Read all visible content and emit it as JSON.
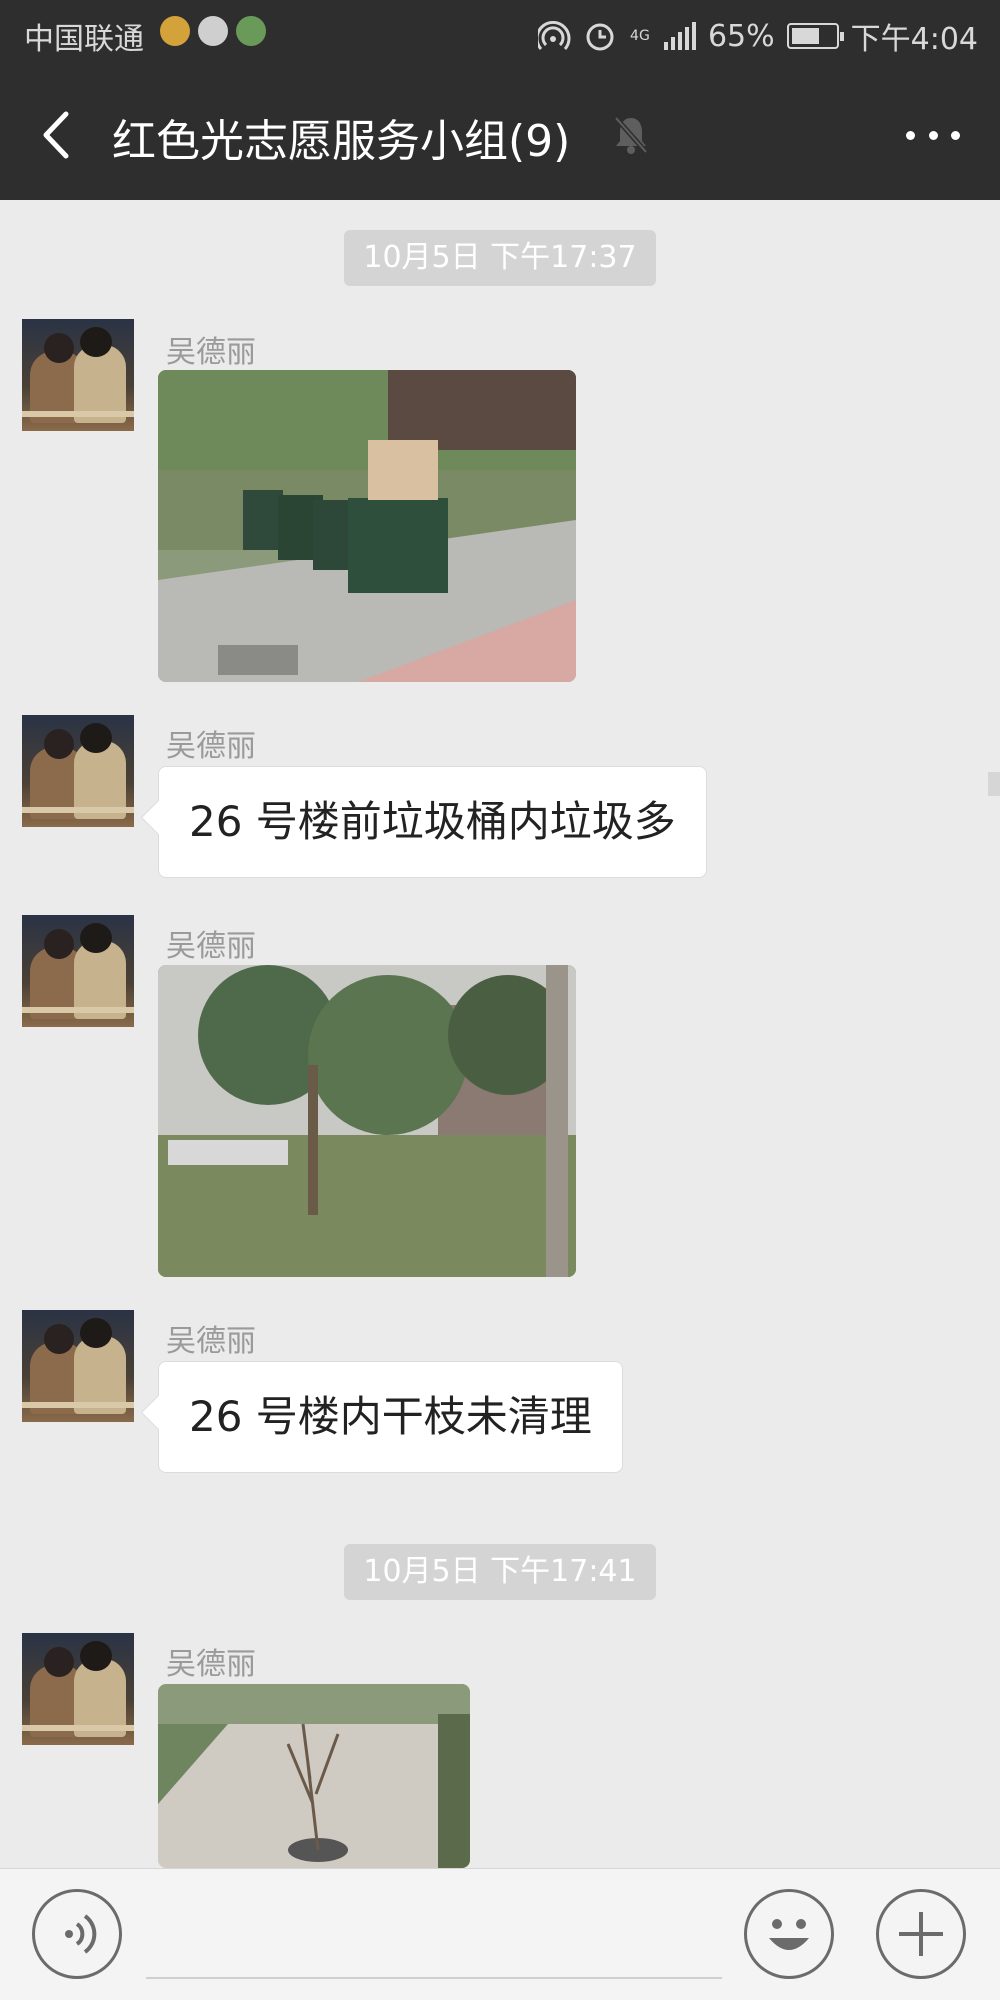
{
  "status_bar": {
    "carrier": "中国联通",
    "battery_percent_text": "65%",
    "battery_level": 0.65,
    "network": "4G",
    "time": "下午4:04"
  },
  "header": {
    "title": "红色光志愿服务小组(9)",
    "muted": true
  },
  "messages": [
    {
      "type": "timestamp",
      "text": "10月5日 下午17:37"
    },
    {
      "type": "image",
      "sender": "吴德丽"
    },
    {
      "type": "text",
      "sender": "吴德丽",
      "text": "26 号楼前垃圾桶内垃圾多"
    },
    {
      "type": "image",
      "sender": "吴德丽"
    },
    {
      "type": "text",
      "sender": "吴德丽",
      "text": "26 号楼内干枝未清理"
    },
    {
      "type": "timestamp",
      "text": "10月5日 下午17:41"
    },
    {
      "type": "image",
      "sender": "吴德丽"
    }
  ],
  "input_bar": {
    "placeholder": ""
  },
  "icons": [
    "back-arrow-icon",
    "mute-bell-icon",
    "more-icon",
    "voice-icon",
    "emoji-icon",
    "plus-icon"
  ]
}
